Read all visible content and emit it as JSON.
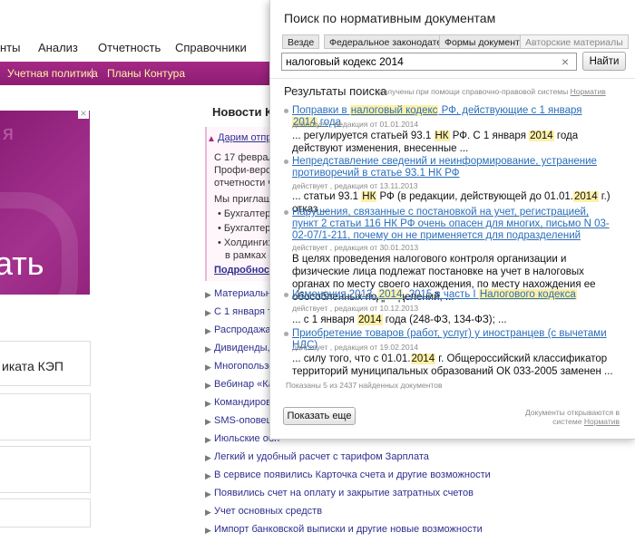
{
  "background": {
    "top_nav": [
      "нты",
      "Анализ",
      "Отчетность",
      "Справочники"
    ],
    "sub_nav": [
      "Учетная политика",
      "Планы Контура"
    ],
    "sub_nav_separator": "|",
    "promo": {
      "faded_text": "я",
      "big_text": "ать",
      "close": "×"
    },
    "cards": [
      "иката КЭП"
    ],
    "news": {
      "title": "Новости Ко",
      "highlight_link": "Дарим отправ",
      "lines": [
        "С 17 февраля",
        "Профи-версии",
        "отчетности че",
        "Мы приглаша"
      ],
      "bullets": [
        "Бухгалтерс",
        "Бухгалтеро",
        "Холдинги: к",
        "в рамках од"
      ],
      "more": "Подробности"
    },
    "news_list": [
      "Материальна",
      "С 1 января тар",
      "Распродажа г",
      "Дивиденды, к",
      "Многопользо",
      "Вебинар «Как",
      "Командировк",
      "SMS-оповеще",
      "Июльские обн",
      "Легкий и удобный расчет с тарифом Зарплата",
      "В сервисе появились Карточка счета и другие возможности",
      "Появились счет на оплату и закрытие затратных счетов",
      "Учет основных средств",
      "Импорт банковской выписки и другие новые возможности"
    ]
  },
  "panel": {
    "title": "Поиск по нормативным документам",
    "tabs": [
      {
        "label": "Везде",
        "disabled": false
      },
      {
        "label": "Федеральное законодательство",
        "disabled": false
      },
      {
        "label": "Формы документов",
        "disabled": false
      },
      {
        "label": "Авторские материалы",
        "disabled": true
      }
    ],
    "search": {
      "value": "налоговый кодекс 2014",
      "clear": "×",
      "button": "Найти"
    },
    "results_title": "Результаты поиска",
    "results_note": "получены при помощи справочно-правовой системы",
    "results_note_link": "Норматив",
    "results": [
      {
        "title_parts": [
          {
            "t": "Поправки в ",
            "h": false
          },
          {
            "t": "налоговый кодекс",
            "h": true
          },
          {
            "t": " РФ, действующие с 1 января ",
            "h": false
          },
          {
            "t": "2014",
            "h": true
          },
          {
            "t": " года",
            "h": false
          }
        ],
        "meta": "действует , редакция от 01.01.2014",
        "snippet_parts": [
          {
            "t": "... регулируется статьей 93.1 ",
            "h": false
          },
          {
            "t": "НК",
            "h": true
          },
          {
            "t": " РФ. С 1 января ",
            "h": false
          },
          {
            "t": "2014",
            "h": true
          },
          {
            "t": " года действуют изменения, внесенные ...",
            "h": false
          }
        ]
      },
      {
        "title_parts": [
          {
            "t": "Непредставление сведений и неинформирование, устранение противоречий в статье 93.1 НК РФ",
            "h": false
          }
        ],
        "meta": "действует , редакция от 13.11.2013",
        "snippet_parts": [
          {
            "t": "... статьи 93.1 ",
            "h": false
          },
          {
            "t": "НК",
            "h": true
          },
          {
            "t": " РФ (в редакции, действующей до 01.01.",
            "h": false
          },
          {
            "t": "2014",
            "h": true
          },
          {
            "t": " г.) отказ ...",
            "h": false
          }
        ]
      },
      {
        "title_parts": [
          {
            "t": "Нарушения, связанные с постановкой на учет, регистрацией, пункт 2 статьи 116 НК РФ очень опасен для многих, письмо N 03-02-07/1-211, почему он не применяется для подразделений",
            "h": false
          }
        ],
        "meta": "действует , редакция от 30.01.2013",
        "snippet_parts": [
          {
            "t": "В целях проведения налогового контроля организации и физические лица подлежат постановке на учет в налоговых органах по месту своего нахождения, по месту нахождения ее обособленных подразделений, ...",
            "h": false
          }
        ]
      },
      {
        "title_parts": [
          {
            "t": "Изменения 2013, ",
            "h": false
          },
          {
            "t": "2014",
            "h": true
          },
          {
            "t": ", 2015 в часть I ",
            "h": false
          },
          {
            "t": "Налогового кодекса",
            "h": true
          }
        ],
        "meta": "действует , редакция от 10.12.2013",
        "snippet_parts": [
          {
            "t": "... с 1 января ",
            "h": false
          },
          {
            "t": "2014",
            "h": true
          },
          {
            "t": " года (248-ФЗ, 134-ФЗ); ...",
            "h": false
          }
        ]
      },
      {
        "title_parts": [
          {
            "t": "Приобретение товаров (работ, услуг) у иностранцев (с вычетами НДС)",
            "h": false
          }
        ],
        "meta": "действует , редакция от 19.02.2014",
        "snippet_parts": [
          {
            "t": "... силу того, что с 01.01.",
            "h": false
          },
          {
            "t": "2014",
            "h": true
          },
          {
            "t": " г. Общероссийский классификатор территорий муниципальных образований ОК 033-2005 заменен ...",
            "h": false
          }
        ]
      }
    ],
    "results_count": "Показаны 5 из 2437 найденных документов",
    "more_button": "Показать еще",
    "footer_note": "Документы открываются в системе",
    "footer_link": "Норматив"
  }
}
